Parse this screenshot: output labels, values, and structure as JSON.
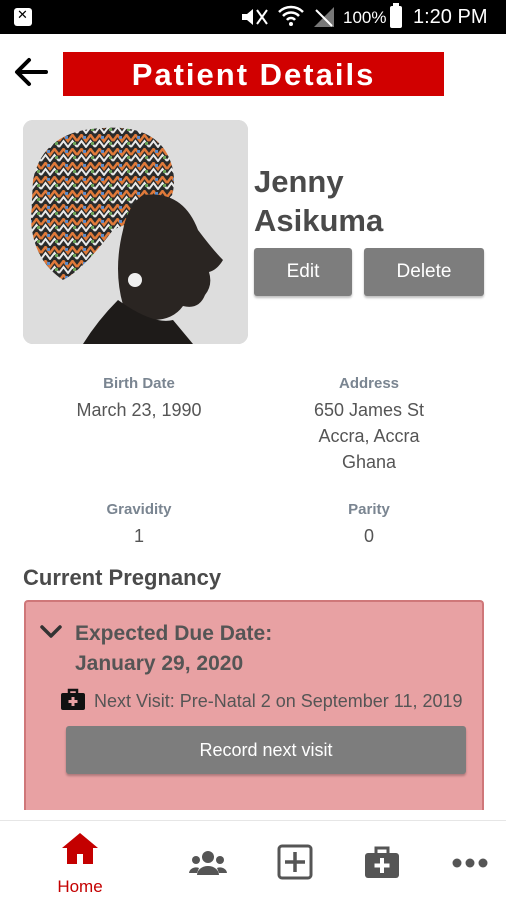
{
  "status_bar": {
    "battery": "100%",
    "time": "1:20 PM"
  },
  "header": {
    "title": "Patient Details"
  },
  "patient": {
    "first_name": "Jenny",
    "last_name": "Asikuma",
    "birth_date_label": "Birth Date",
    "birth_date": "March 23, 1990",
    "address_label": "Address",
    "address_line1": "650 James St",
    "address_line2": "Accra, Accra",
    "address_line3": "Ghana",
    "gravidity_label": "Gravidity",
    "gravidity": "1",
    "parity_label": "Parity",
    "parity": "0"
  },
  "actions": {
    "edit": "Edit",
    "delete": "Delete"
  },
  "pregnancy": {
    "section_title": "Current Pregnancy",
    "due_label": "Expected Due Date:",
    "due_date": "January 29, 2020",
    "next_visit": "Next Visit: Pre-Natal 2 on September 11, 2019",
    "record_button": "Record next visit"
  },
  "nav": {
    "home_label": "Home",
    "active_color": "#c40000",
    "inactive_color": "#555555",
    "items": [
      "home-icon",
      "patients-icon",
      "add-icon",
      "medkit-icon",
      "more-icon"
    ]
  },
  "colors": {
    "brand_red": "#d10000",
    "card_bg": "#e8a1a3",
    "button_gray": "#7d7d7d"
  }
}
